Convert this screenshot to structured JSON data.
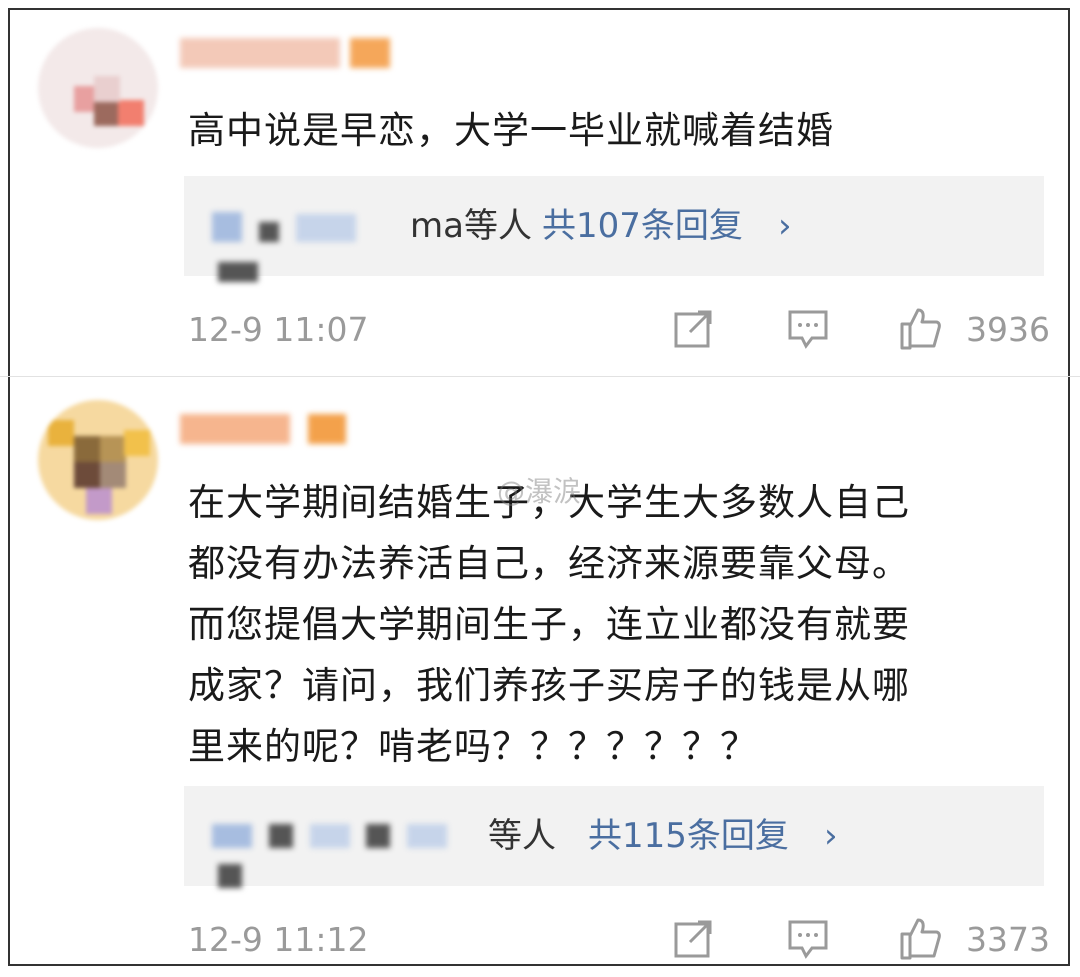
{
  "comments": [
    {
      "text": "高中说是早恋，大学一毕业就喊着结婚",
      "reply_users_suffix": "ma等人",
      "reply_count_label": "共107条回复",
      "time": "12-9 11:07",
      "likes": "3936"
    },
    {
      "text_lines": [
        "在大学期间结婚生子，大学生大多数人自己",
        "都没有办法养活自己，经济来源要靠父母。",
        "而您提倡大学期间生子，连立业都没有就要",
        "成家？请问，我们养孩子买房子的钱是从哪",
        "里来的呢？啃老吗？？？？？？？"
      ],
      "reply_users_suffix": "等人",
      "reply_count_label": "共115条回复",
      "time": "12-9 11:12",
      "likes": "3373"
    }
  ],
  "chevron": "›",
  "watermark": "@瀑涙",
  "icons": [
    "share-icon",
    "comment-icon",
    "like-icon"
  ],
  "colors": {
    "link": "#4a6ea0",
    "meta": "#9a9a9a",
    "reply_bg": "#f2f2f2"
  }
}
